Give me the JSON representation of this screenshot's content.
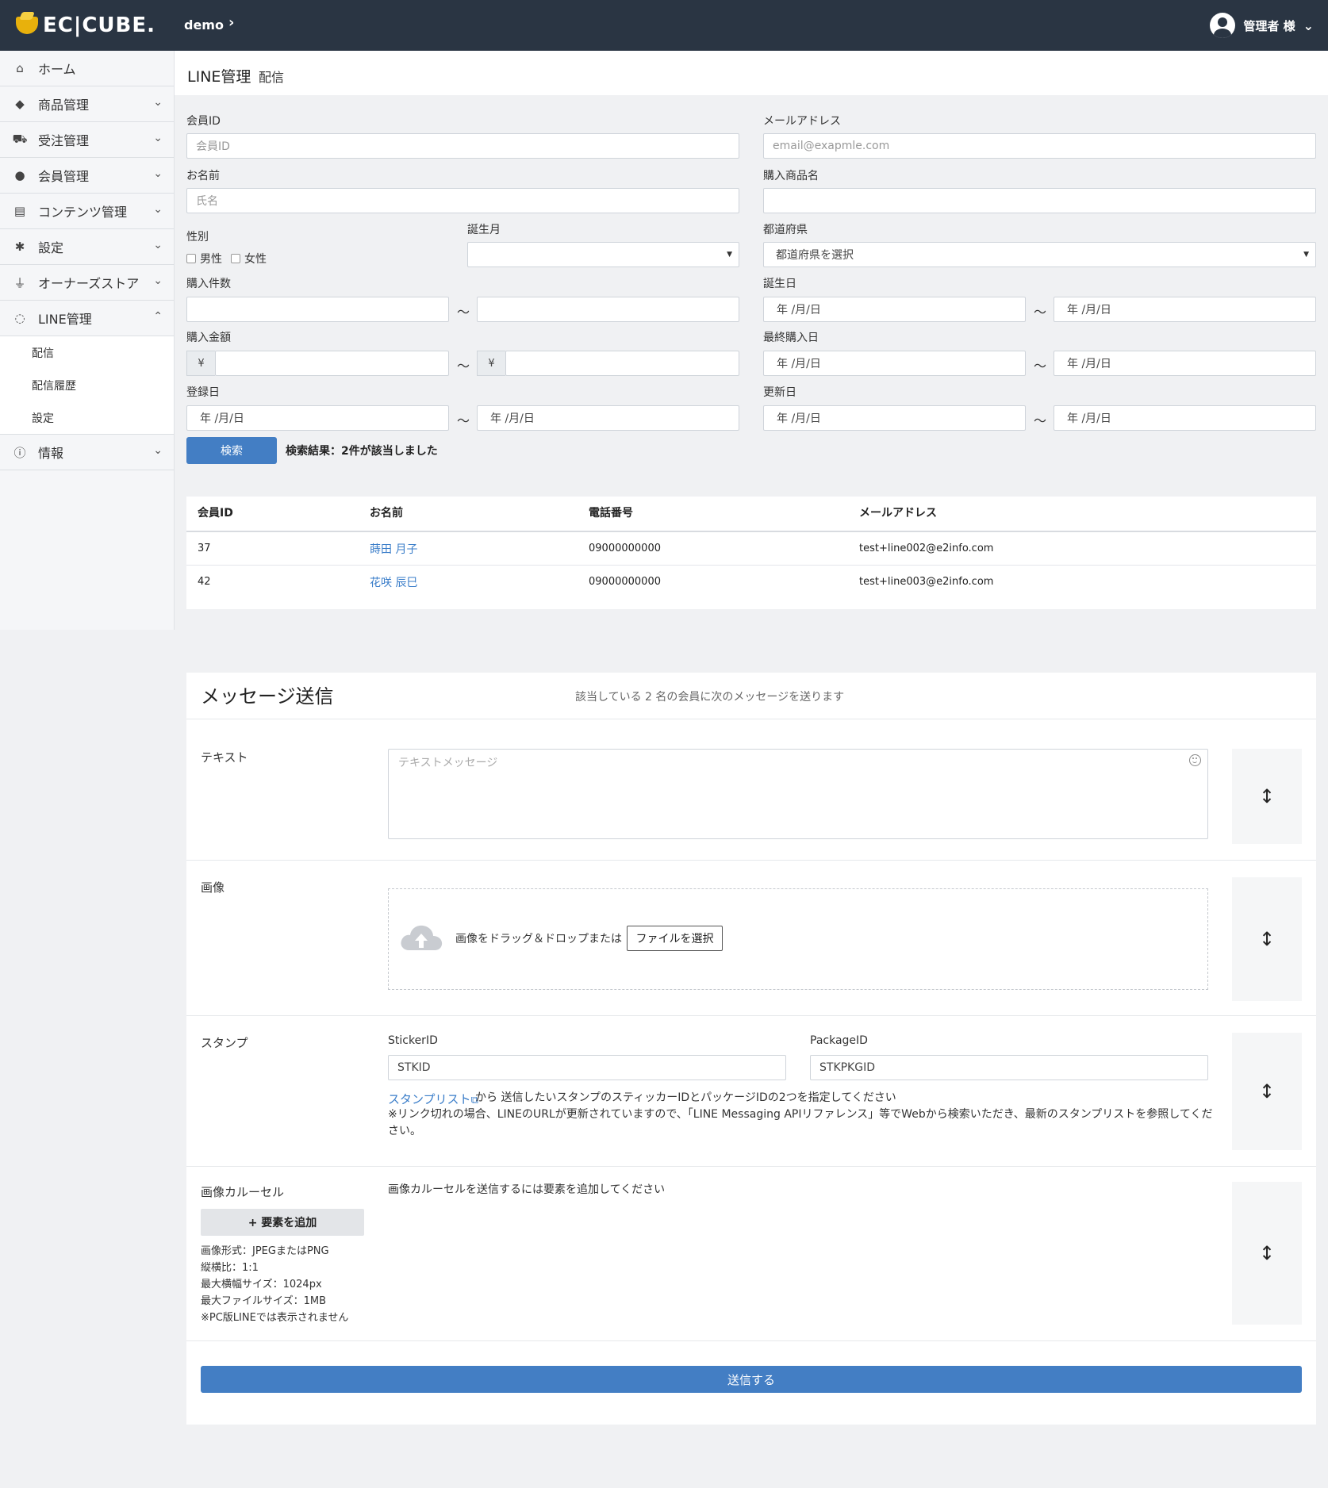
{
  "header": {
    "logo_text": "EC|CUBE.",
    "shop_name": "demo",
    "shop_chevron": "›",
    "user_name": "管理者 様",
    "user_chevron": "⌄"
  },
  "sidebar": {
    "items": [
      {
        "label": "ホーム",
        "icon": "home-icon",
        "glyph": "⌂"
      },
      {
        "label": "商品管理",
        "icon": "cube-icon",
        "glyph": "◆"
      },
      {
        "label": "受注管理",
        "icon": "cart-icon",
        "glyph": "⛟"
      },
      {
        "label": "会員管理",
        "icon": "users-icon",
        "glyph": "●"
      },
      {
        "label": "コンテンツ管理",
        "icon": "file-icon",
        "glyph": "▤"
      },
      {
        "label": "設定",
        "icon": "gear-icon",
        "glyph": "✱"
      },
      {
        "label": "オーナーズストア",
        "icon": "plug-icon",
        "glyph": "⏚"
      },
      {
        "label": "LINE管理",
        "icon": "chat-icon",
        "glyph": "◌"
      },
      {
        "label": "情報",
        "icon": "info-icon",
        "glyph": "ⓘ"
      }
    ],
    "line_sub": [
      "配信",
      "配信履歴",
      "設定"
    ],
    "chevron_down": "⌄",
    "chevron_up": "⌃"
  },
  "page": {
    "title": "LINE管理",
    "subtitle": "配信"
  },
  "form": {
    "member_id_label": "会員ID",
    "member_id_placeholder": "会員ID",
    "email_label": "メールアドレス",
    "email_placeholder": "email@exapmle.com",
    "name_label": "お名前",
    "name_placeholder": "氏名",
    "product_label": "購入商品名",
    "gender_label": "性別",
    "male": "男性",
    "female": "女性",
    "birth_month_label": "誕生月",
    "pref_label": "都道府県",
    "pref_value": "都道府県を選択",
    "buy_count_label": "購入件数",
    "birthday_label": "誕生日",
    "buy_amount_label": "購入金額",
    "yen": "¥",
    "last_buy_label": "最終購入日",
    "reg_label": "登録日",
    "update_label": "更新日",
    "date_placeholder": "年 /月/日",
    "tilde": "〜",
    "search_btn": "検索",
    "result": "検索結果：2件が該当しました"
  },
  "table": {
    "headers": [
      "会員ID",
      "お名前",
      "電話番号",
      "メールアドレス"
    ],
    "rows": [
      {
        "id": "37",
        "name": "蒔田 月子",
        "tel": "09000000000",
        "email": "test+line002@e2info.com"
      },
      {
        "id": "42",
        "name": "花咲 辰巳",
        "tel": "09000000000",
        "email": "test+line003@e2info.com"
      }
    ]
  },
  "message": {
    "title": "メッセージ送信",
    "desc": "該当している 2 名の会員に次のメッセージを送ります",
    "text_label": "テキスト",
    "text_placeholder": "テキストメッセージ",
    "image_label": "画像",
    "drop_text": "画像をドラッグ＆ドロップまたは",
    "file_btn": "ファイルを選択",
    "stamp_label": "スタンプ",
    "sticker_label": "StickerID",
    "sticker_placeholder": "STKID",
    "package_label": "PackageID",
    "package_placeholder": "STKPKGID",
    "stamp_link": "スタンプリスト",
    "stamp_help": "から 送信したいスタンプのスティッカーIDとパッケージIDの2つを指定してください",
    "stamp_note1": "※リンク切れの場合、LINEのURLが更新されていますので、「LINE Messaging APIリファレンス」等でWebから検索いただき、最新のスタンプリストを参照してくだ",
    "stamp_note2": "さい。",
    "carousel_label": "画像カルーセル",
    "carousel_hint": "画像カルーセルを送信するには要素を追加してください",
    "add_btn": "+ 要素を追加",
    "spec1": "画像形式：JPEGまたはPNG",
    "spec2": "縦横比：1:1",
    "spec3": "最大横幅サイズ：1024px",
    "spec4": "最大ファイルサイズ：1MB",
    "spec5": "※PC版LINEでは表示されません",
    "handle": "↕",
    "send_btn": "送信する"
  }
}
